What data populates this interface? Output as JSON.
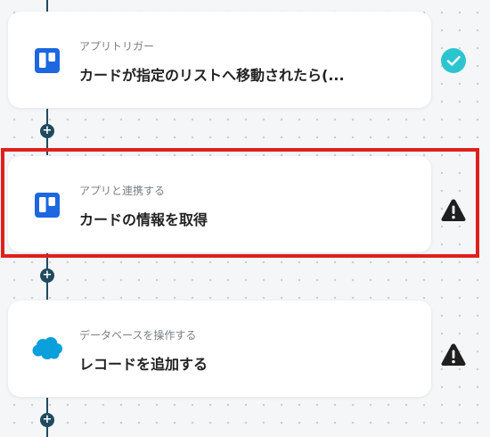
{
  "steps": [
    {
      "subtitle": "アプリトリガー",
      "title": "カードが指定のリストへ移動されたら(...",
      "icon": "trello-icon",
      "status": "check-circle-icon"
    },
    {
      "subtitle": "アプリと連携する",
      "title": "カードの情報を取得",
      "icon": "trello-icon",
      "status": "warning-icon"
    },
    {
      "subtitle": "データベースを操作する",
      "title": "レコードを追加する",
      "icon": "salesforce-cloud-icon",
      "status": "warning-icon"
    }
  ],
  "add_symbol": "+",
  "colors": {
    "trello_blue": "#1d67e0",
    "salesforce_blue": "#0b9fdb",
    "success_teal": "#2cc5cf",
    "warning_dark": "#1f1f1f",
    "connector": "#1f4b5e",
    "highlight_red": "#e0201c"
  }
}
